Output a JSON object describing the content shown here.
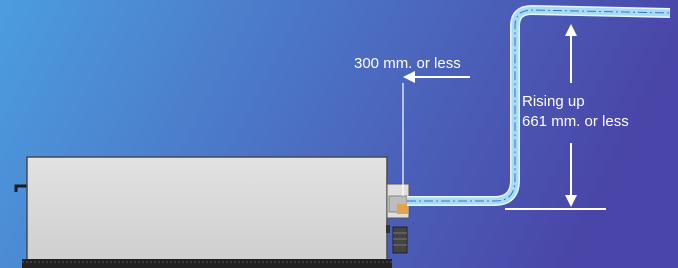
{
  "colors": {
    "background_left": "#4c9de0",
    "background_right": "#4a45a8",
    "pipe": "#a9dcf4",
    "unit_body": "#d7d7d7",
    "annotation": "#ffffff"
  },
  "labels": {
    "horizontal_distance": "300 mm. or less",
    "rise_line1": "Rising up",
    "rise_line2": "661 mm. or less"
  },
  "icons": [
    "arrow-left-icon",
    "arrow-up-icon",
    "arrow-down-icon"
  ]
}
